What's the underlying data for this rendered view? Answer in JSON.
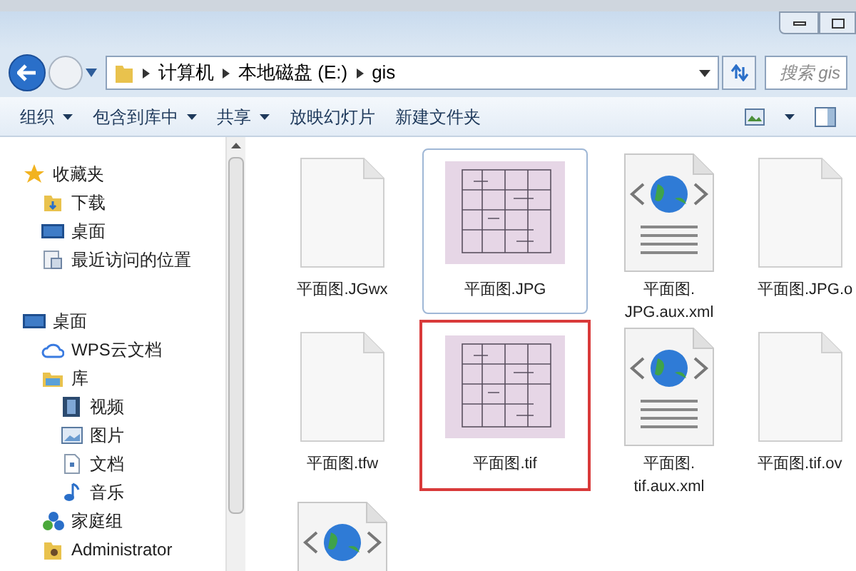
{
  "address": {
    "crumbs": [
      "计算机",
      "本地磁盘 (E:)",
      "gis"
    ]
  },
  "search": {
    "placeholder": "搜索 gis"
  },
  "toolbar": [
    {
      "label": "组织",
      "menu": true
    },
    {
      "label": "包含到库中",
      "menu": true
    },
    {
      "label": "共享",
      "menu": true
    },
    {
      "label": "放映幻灯片",
      "menu": false
    },
    {
      "label": "新建文件夹",
      "menu": false
    }
  ],
  "sidebar": {
    "groups": [
      {
        "label": "收藏夹",
        "children": [
          {
            "label": "下载"
          },
          {
            "label": "桌面"
          },
          {
            "label": "最近访问的位置"
          }
        ]
      },
      {
        "label": "桌面",
        "children": [
          {
            "label": "WPS云文档"
          },
          {
            "label": "库",
            "children": [
              {
                "label": "视频"
              },
              {
                "label": "图片"
              },
              {
                "label": "文档"
              },
              {
                "label": "音乐"
              }
            ]
          },
          {
            "label": "家庭组"
          },
          {
            "label": "Administrator"
          }
        ]
      }
    ]
  },
  "files": [
    {
      "name": "平面图.JGwx",
      "kind": "blank",
      "selected": false,
      "marked": false
    },
    {
      "name": "平面图.JPG",
      "kind": "image",
      "selected": true,
      "marked": false
    },
    {
      "name": "平面图.\nJPG.aux.xml",
      "kind": "xml",
      "selected": false,
      "marked": false
    },
    {
      "name": "平面图.JPG.o",
      "kind": "blank",
      "selected": false,
      "marked": false
    },
    {
      "name": "平面图.tfw",
      "kind": "blank",
      "selected": false,
      "marked": false
    },
    {
      "name": "平面图.tif",
      "kind": "image",
      "selected": false,
      "marked": true
    },
    {
      "name": "平面图.\ntif.aux.xml",
      "kind": "xml",
      "selected": false,
      "marked": false
    },
    {
      "name": "平面图.tif.ov",
      "kind": "blank",
      "selected": false,
      "marked": false
    },
    {
      "kind": "xml",
      "selected": false,
      "marked": false
    }
  ]
}
